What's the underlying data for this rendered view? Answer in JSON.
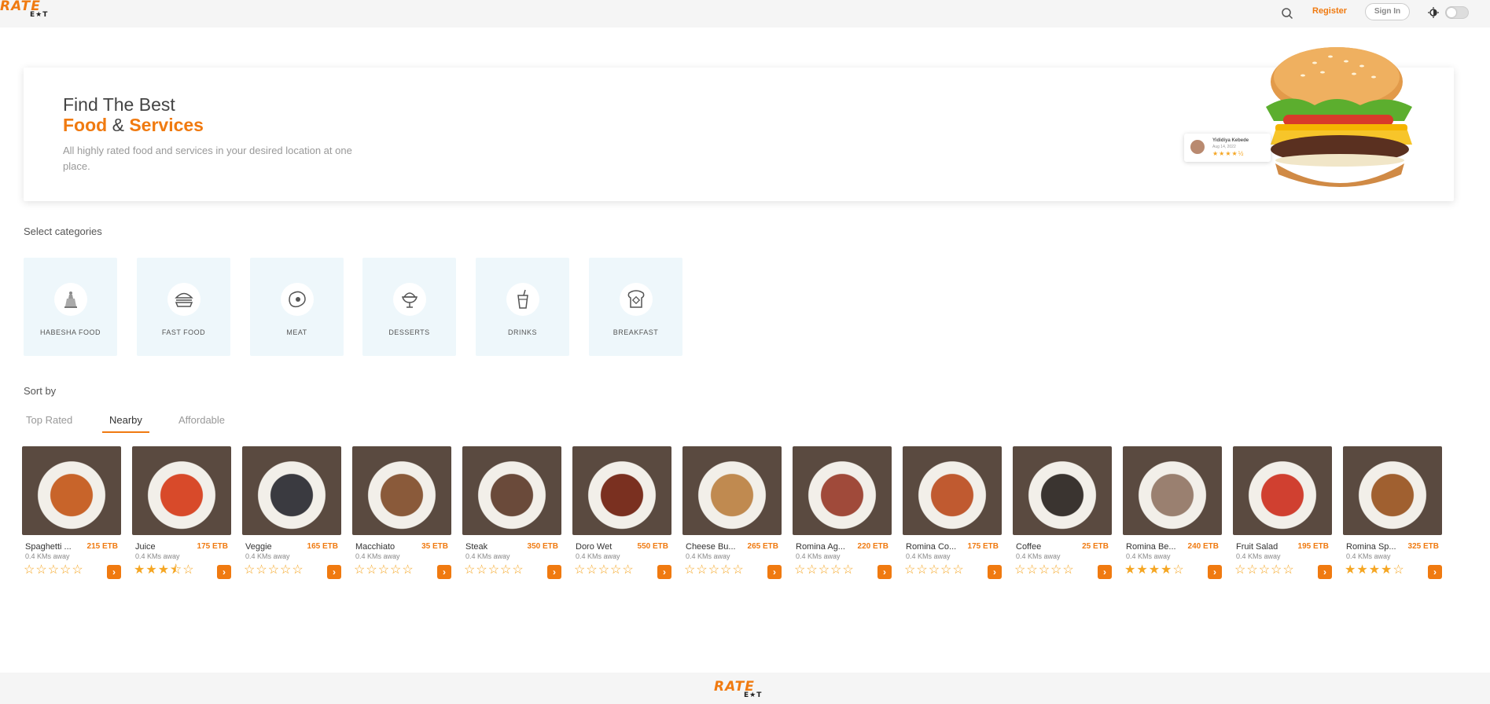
{
  "header": {
    "logo_top": "RATE",
    "logo_bottom": "E★T",
    "search_icon": "search-icon",
    "register_label": "Register",
    "signin_label": "Sign In",
    "theme_icon": "brightness-icon"
  },
  "hero": {
    "title_line1": "Find The Best",
    "title_food": "Food",
    "title_amp": "&",
    "title_services": "Services",
    "subtitle": "All highly rated food and services in your desired location at one place.",
    "review": {
      "name": "Yididiya Kebede",
      "date": "Aug 14, 2022",
      "stars": "★★★★½"
    }
  },
  "categories": {
    "title": "Select categories",
    "items": [
      {
        "label": "HABESHA FOOD",
        "icon": "jebena-icon"
      },
      {
        "label": "FAST FOOD",
        "icon": "burger-icon"
      },
      {
        "label": "MEAT",
        "icon": "meat-icon"
      },
      {
        "label": "DESSERTS",
        "icon": "icecream-icon"
      },
      {
        "label": "DRINKS",
        "icon": "drink-icon"
      },
      {
        "label": "BREAKFAST",
        "icon": "toast-icon"
      }
    ]
  },
  "sort": {
    "title": "Sort by",
    "tabs": [
      {
        "label": "Top Rated",
        "active": false
      },
      {
        "label": "Nearby",
        "active": true
      },
      {
        "label": "Affordable",
        "active": false
      }
    ]
  },
  "foods": [
    {
      "name": "Spaghetti ...",
      "price": "215 ETB",
      "distance": "0.4 KMs away",
      "rating": 0,
      "color": "#c8642a"
    },
    {
      "name": "Juice",
      "price": "175 ETB",
      "distance": "0.4 KMs away",
      "rating": 3.5,
      "color": "#d84a2a"
    },
    {
      "name": "Veggie",
      "price": "165 ETB",
      "distance": "0.4 KMs away",
      "rating": 0,
      "color": "#3a3a40"
    },
    {
      "name": "Macchiato",
      "price": "35 ETB",
      "distance": "0.4 KMs away",
      "rating": 0,
      "color": "#8a5a3a"
    },
    {
      "name": "Steak",
      "price": "350 ETB",
      "distance": "0.4 KMs away",
      "rating": 0,
      "color": "#6a4a3a"
    },
    {
      "name": "Doro Wet",
      "price": "550 ETB",
      "distance": "0.4 KMs away",
      "rating": 0,
      "color": "#7a3020"
    },
    {
      "name": "Cheese Bu...",
      "price": "265 ETB",
      "distance": "0.4 KMs away",
      "rating": 0,
      "color": "#c08a50"
    },
    {
      "name": "Romina Ag...",
      "price": "220 ETB",
      "distance": "0.4 KMs away",
      "rating": 0,
      "color": "#a04a3a"
    },
    {
      "name": "Romina Co...",
      "price": "175 ETB",
      "distance": "0.4 KMs away",
      "rating": 0,
      "color": "#c05a30"
    },
    {
      "name": "Coffee",
      "price": "25 ETB",
      "distance": "0.4 KMs away",
      "rating": 0,
      "color": "#3a3430"
    },
    {
      "name": "Romina Be...",
      "price": "240 ETB",
      "distance": "0.4 KMs away",
      "rating": 4,
      "color": "#9a8070"
    },
    {
      "name": "Fruit Salad",
      "price": "195 ETB",
      "distance": "0.4 KMs away",
      "rating": 0,
      "color": "#d04030"
    },
    {
      "name": "Romina Sp...",
      "price": "325 ETB",
      "distance": "0.4 KMs away",
      "rating": 4,
      "color": "#a06030"
    }
  ],
  "colors": {
    "accent": "#f07a10",
    "star": "#f5a623",
    "category_bg": "#eef7fb"
  }
}
